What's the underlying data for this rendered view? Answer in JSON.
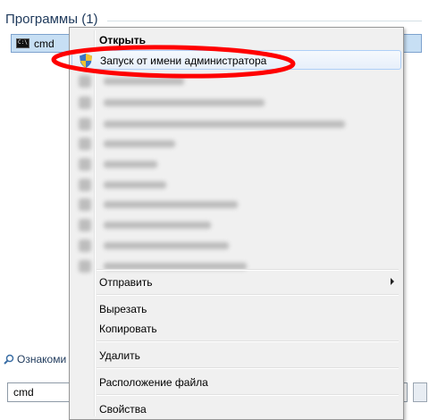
{
  "start_menu": {
    "section_title": "Программы (1)",
    "program": {
      "label": "cmd",
      "icon": "console-icon"
    },
    "see_more_label": "Ознакоми",
    "search": {
      "value": "cmd"
    }
  },
  "context_menu": {
    "open_label": "Открыть",
    "run_as_admin_label": "Запуск от имени администратора",
    "send_to_label": "Отправить",
    "cut_label": "Вырезать",
    "copy_label": "Копировать",
    "delete_label": "Удалить",
    "file_location_label": "Расположение файла",
    "properties_label": "Свойства"
  },
  "colors": {
    "annotation": "#ff0000",
    "highlight": "#c7dff4",
    "menu_background": "#f0f0f0",
    "title_text": "#1e395b"
  }
}
